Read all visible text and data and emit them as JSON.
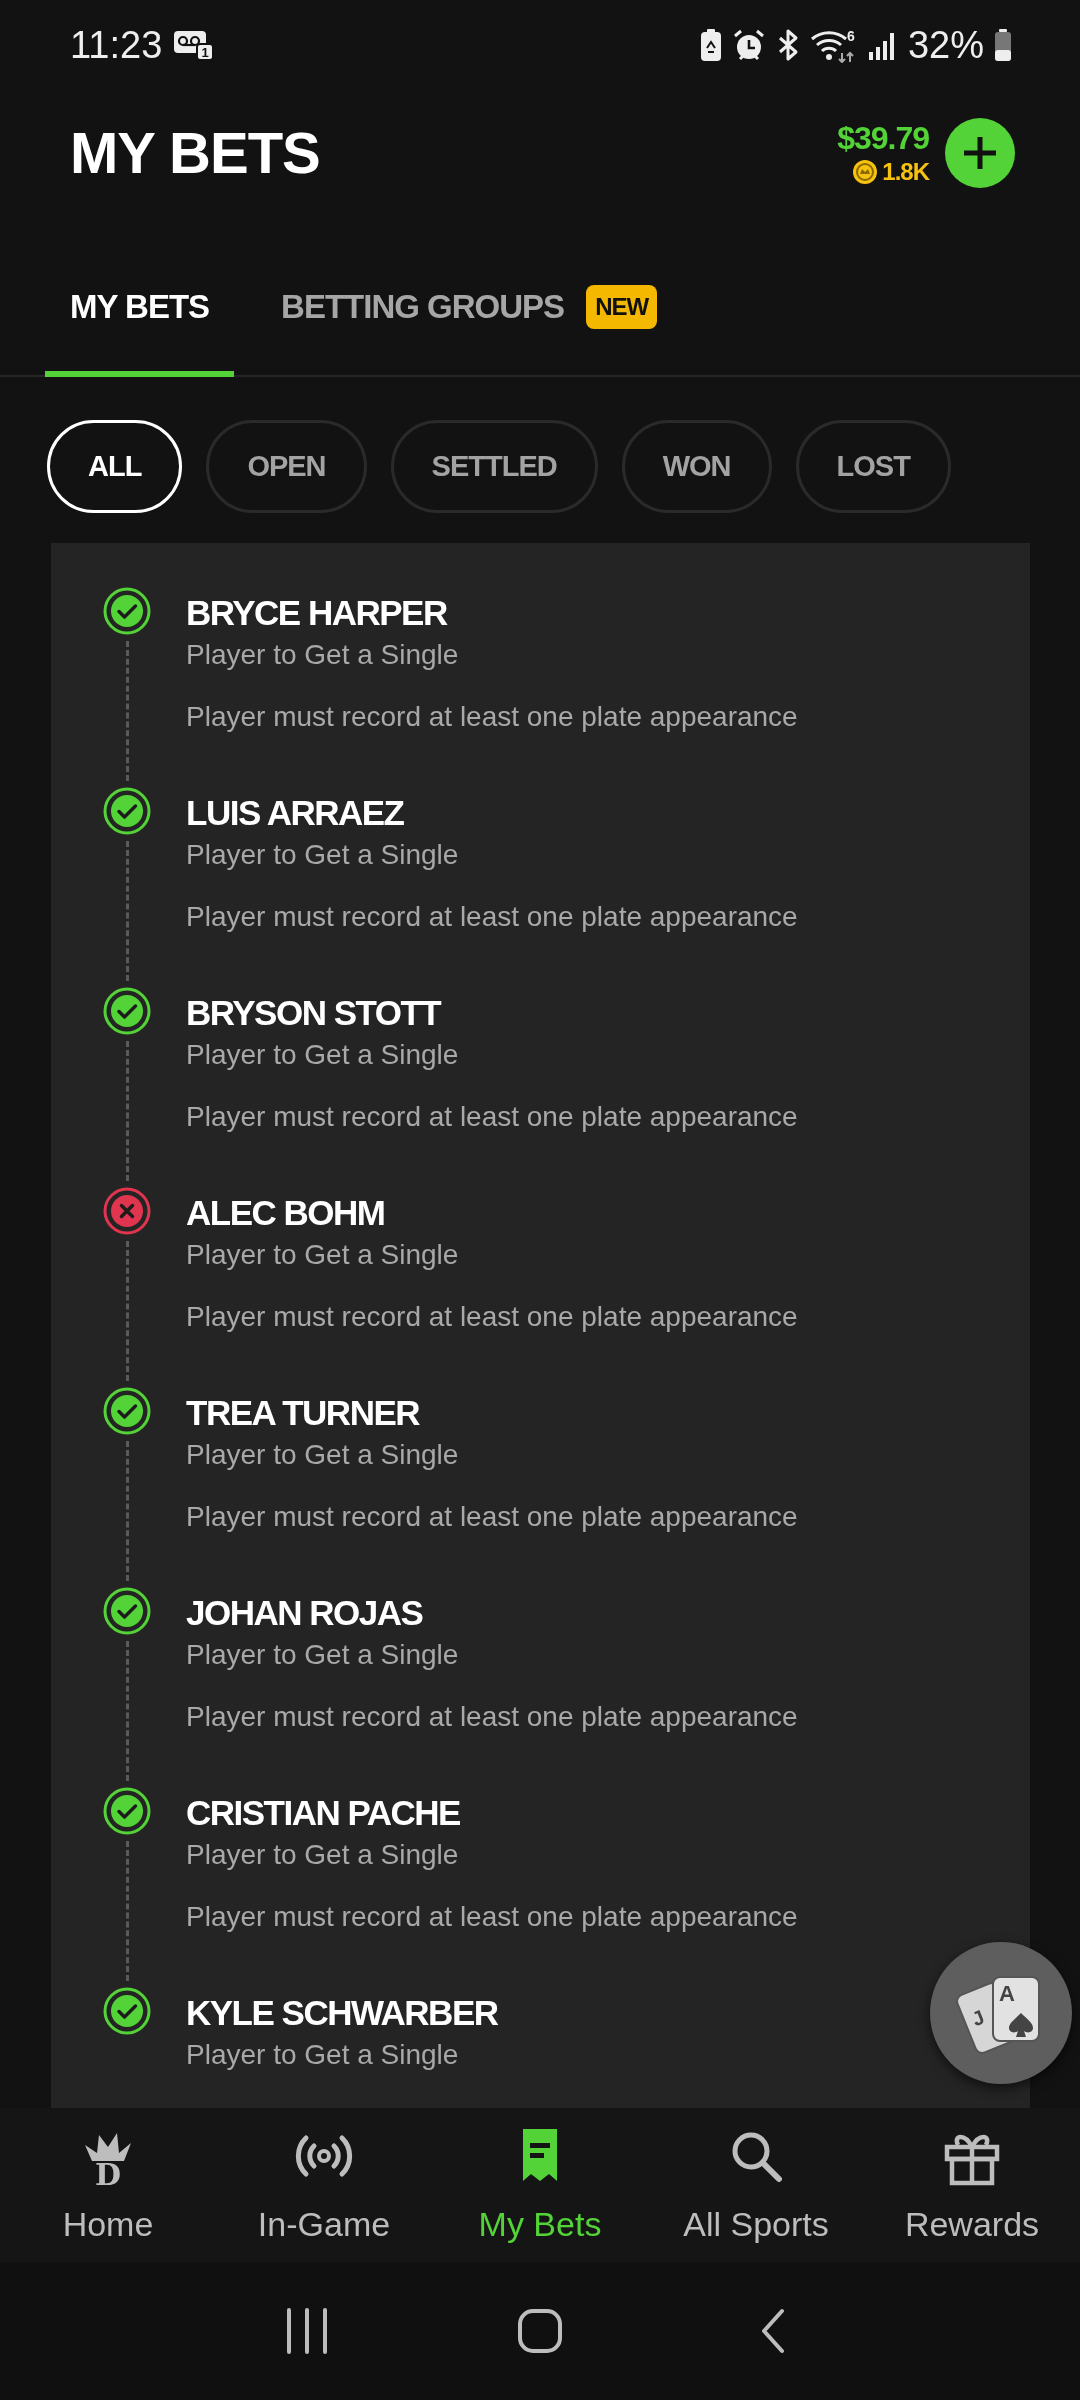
{
  "status_bar": {
    "time": "11:23",
    "voicemail_count": "1",
    "wifi_generation": "6",
    "battery": "32%"
  },
  "header": {
    "title": "MY BETS",
    "balance": "$39.79",
    "coins": "1.8K"
  },
  "tabs": [
    {
      "label": "MY BETS",
      "selected": true
    },
    {
      "label": "BETTING GROUPS",
      "selected": false,
      "badge": "NEW"
    }
  ],
  "filters": [
    {
      "label": "ALL",
      "selected": true
    },
    {
      "label": "OPEN",
      "selected": false
    },
    {
      "label": "SETTLED",
      "selected": false
    },
    {
      "label": "WON",
      "selected": false
    },
    {
      "label": "LOST",
      "selected": false
    }
  ],
  "legs": [
    {
      "player": "BRYCE HARPER",
      "market": "Player to Get a Single",
      "note": "Player must record at least one plate appearance",
      "won": true
    },
    {
      "player": "LUIS ARRAEZ",
      "market": "Player to Get a Single",
      "note": "Player must record at least one plate appearance",
      "won": true
    },
    {
      "player": "BRYSON STOTT",
      "market": "Player to Get a Single",
      "note": "Player must record at least one plate appearance",
      "won": true
    },
    {
      "player": "ALEC BOHM",
      "market": "Player to Get a Single",
      "note": "Player must record at least one plate appearance",
      "won": false
    },
    {
      "player": "TREA TURNER",
      "market": "Player to Get a Single",
      "note": "Player must record at least one plate appearance",
      "won": true
    },
    {
      "player": "JOHAN ROJAS",
      "market": "Player to Get a Single",
      "note": "Player must record at least one plate appearance",
      "won": true
    },
    {
      "player": "CRISTIAN PACHE",
      "market": "Player to Get a Single",
      "note": "Player must record at least one plate appearance",
      "won": true
    },
    {
      "player": "KYLE SCHWARBER",
      "market": "Player to Get a Single",
      "won": true
    }
  ],
  "casino_button": {
    "cards": [
      "J",
      "A"
    ]
  },
  "bottom_nav": [
    {
      "label": "Home",
      "selected": false,
      "logo_letter": "D"
    },
    {
      "label": "In-Game",
      "selected": false
    },
    {
      "label": "My Bets",
      "selected": true
    },
    {
      "label": "All Sports",
      "selected": false
    },
    {
      "label": "Rewards",
      "selected": false
    }
  ]
}
